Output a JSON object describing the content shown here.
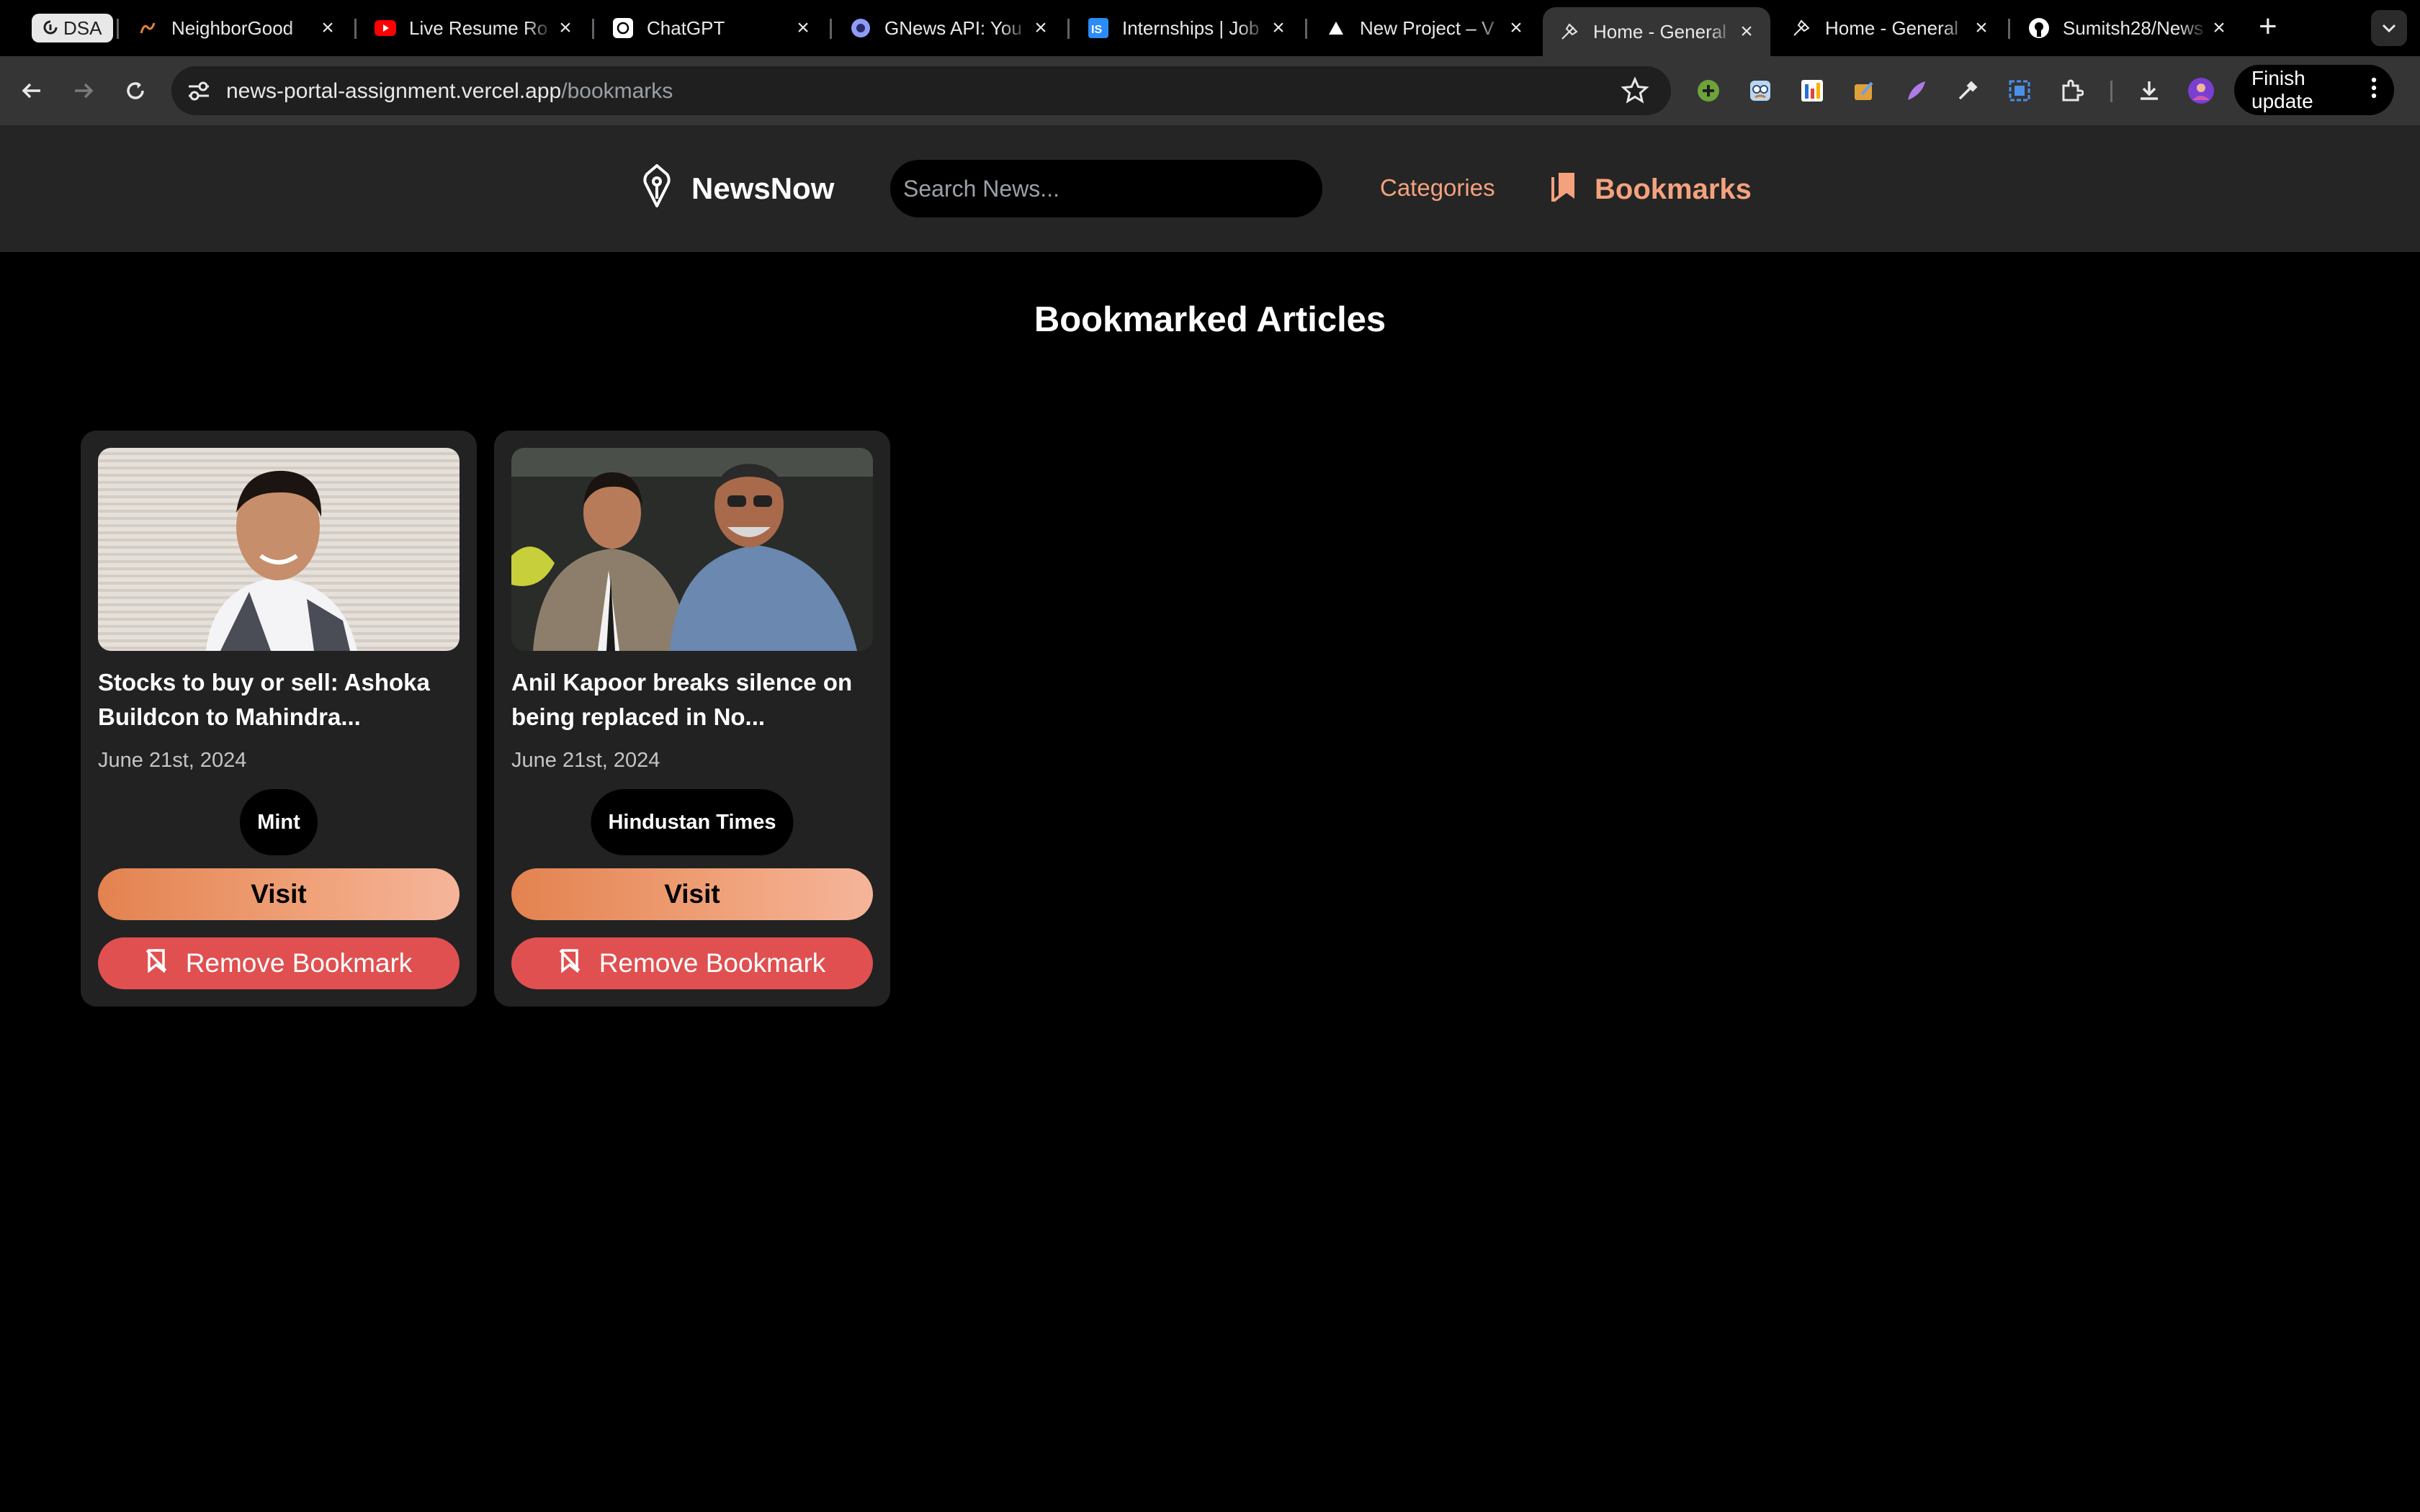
{
  "browser": {
    "tab_group_label": "DSA",
    "tabs": [
      {
        "title": "NeighborGood",
        "icon": "neighborgood-icon"
      },
      {
        "title": "Live Resume Ro",
        "icon": "youtube-icon"
      },
      {
        "title": "ChatGPT",
        "icon": "chatgpt-icon"
      },
      {
        "title": "GNews API: You",
        "icon": "gnews-icon"
      },
      {
        "title": "Internships | Job",
        "icon": "internshala-icon"
      },
      {
        "title": "New Project – V",
        "icon": "vercel-icon"
      },
      {
        "title": "Home - General",
        "icon": "newsnow-icon",
        "active": true
      },
      {
        "title": "Home - General",
        "icon": "newsnow-icon"
      },
      {
        "title": "Sumitsh28/News",
        "icon": "github-icon"
      }
    ],
    "url_host": "news-portal-assignment.vercel.app",
    "url_path": "/bookmarks",
    "finish_update_label": "Finish update"
  },
  "header": {
    "brand": "NewsNow",
    "search_placeholder": "Search News...",
    "nav_categories": "Categories",
    "nav_bookmarks": "Bookmarks"
  },
  "main": {
    "title": "Bookmarked Articles",
    "articles": [
      {
        "headline": "Stocks to buy or sell: Ashoka Buildcon to Mahindra...",
        "date": "June 21st, 2024",
        "source": "Mint",
        "visit_label": "Visit",
        "remove_label": "Remove Bookmark"
      },
      {
        "headline": "Anil Kapoor breaks silence on being replaced in No...",
        "date": "June 21st, 2024",
        "source": "Hindustan Times",
        "visit_label": "Visit",
        "remove_label": "Remove Bookmark"
      }
    ]
  },
  "colors": {
    "accent": "#f4a27e",
    "visit_gradient_start": "#e3824f",
    "remove_red": "#e05050",
    "header_bg": "#252525",
    "card_bg": "#222222"
  }
}
